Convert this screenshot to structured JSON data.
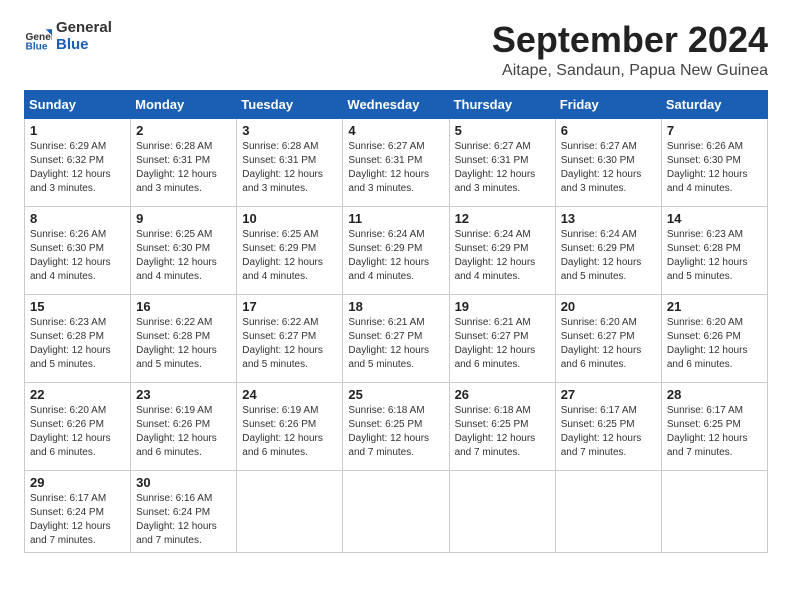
{
  "logo": {
    "line1": "General",
    "line2": "Blue"
  },
  "header": {
    "month": "September 2024",
    "location": "Aitape, Sandaun, Papua New Guinea"
  },
  "weekdays": [
    "Sunday",
    "Monday",
    "Tuesday",
    "Wednesday",
    "Thursday",
    "Friday",
    "Saturday"
  ],
  "weeks": [
    [
      {
        "day": "1",
        "sunrise": "6:29 AM",
        "sunset": "6:32 PM",
        "daylight": "12 hours and 3 minutes."
      },
      {
        "day": "2",
        "sunrise": "6:28 AM",
        "sunset": "6:31 PM",
        "daylight": "12 hours and 3 minutes."
      },
      {
        "day": "3",
        "sunrise": "6:28 AM",
        "sunset": "6:31 PM",
        "daylight": "12 hours and 3 minutes."
      },
      {
        "day": "4",
        "sunrise": "6:27 AM",
        "sunset": "6:31 PM",
        "daylight": "12 hours and 3 minutes."
      },
      {
        "day": "5",
        "sunrise": "6:27 AM",
        "sunset": "6:31 PM",
        "daylight": "12 hours and 3 minutes."
      },
      {
        "day": "6",
        "sunrise": "6:27 AM",
        "sunset": "6:30 PM",
        "daylight": "12 hours and 3 minutes."
      },
      {
        "day": "7",
        "sunrise": "6:26 AM",
        "sunset": "6:30 PM",
        "daylight": "12 hours and 4 minutes."
      }
    ],
    [
      {
        "day": "8",
        "sunrise": "6:26 AM",
        "sunset": "6:30 PM",
        "daylight": "12 hours and 4 minutes."
      },
      {
        "day": "9",
        "sunrise": "6:25 AM",
        "sunset": "6:30 PM",
        "daylight": "12 hours and 4 minutes."
      },
      {
        "day": "10",
        "sunrise": "6:25 AM",
        "sunset": "6:29 PM",
        "daylight": "12 hours and 4 minutes."
      },
      {
        "day": "11",
        "sunrise": "6:24 AM",
        "sunset": "6:29 PM",
        "daylight": "12 hours and 4 minutes."
      },
      {
        "day": "12",
        "sunrise": "6:24 AM",
        "sunset": "6:29 PM",
        "daylight": "12 hours and 4 minutes."
      },
      {
        "day": "13",
        "sunrise": "6:24 AM",
        "sunset": "6:29 PM",
        "daylight": "12 hours and 5 minutes."
      },
      {
        "day": "14",
        "sunrise": "6:23 AM",
        "sunset": "6:28 PM",
        "daylight": "12 hours and 5 minutes."
      }
    ],
    [
      {
        "day": "15",
        "sunrise": "6:23 AM",
        "sunset": "6:28 PM",
        "daylight": "12 hours and 5 minutes."
      },
      {
        "day": "16",
        "sunrise": "6:22 AM",
        "sunset": "6:28 PM",
        "daylight": "12 hours and 5 minutes."
      },
      {
        "day": "17",
        "sunrise": "6:22 AM",
        "sunset": "6:27 PM",
        "daylight": "12 hours and 5 minutes."
      },
      {
        "day": "18",
        "sunrise": "6:21 AM",
        "sunset": "6:27 PM",
        "daylight": "12 hours and 5 minutes."
      },
      {
        "day": "19",
        "sunrise": "6:21 AM",
        "sunset": "6:27 PM",
        "daylight": "12 hours and 6 minutes."
      },
      {
        "day": "20",
        "sunrise": "6:20 AM",
        "sunset": "6:27 PM",
        "daylight": "12 hours and 6 minutes."
      },
      {
        "day": "21",
        "sunrise": "6:20 AM",
        "sunset": "6:26 PM",
        "daylight": "12 hours and 6 minutes."
      }
    ],
    [
      {
        "day": "22",
        "sunrise": "6:20 AM",
        "sunset": "6:26 PM",
        "daylight": "12 hours and 6 minutes."
      },
      {
        "day": "23",
        "sunrise": "6:19 AM",
        "sunset": "6:26 PM",
        "daylight": "12 hours and 6 minutes."
      },
      {
        "day": "24",
        "sunrise": "6:19 AM",
        "sunset": "6:26 PM",
        "daylight": "12 hours and 6 minutes."
      },
      {
        "day": "25",
        "sunrise": "6:18 AM",
        "sunset": "6:25 PM",
        "daylight": "12 hours and 7 minutes."
      },
      {
        "day": "26",
        "sunrise": "6:18 AM",
        "sunset": "6:25 PM",
        "daylight": "12 hours and 7 minutes."
      },
      {
        "day": "27",
        "sunrise": "6:17 AM",
        "sunset": "6:25 PM",
        "daylight": "12 hours and 7 minutes."
      },
      {
        "day": "28",
        "sunrise": "6:17 AM",
        "sunset": "6:25 PM",
        "daylight": "12 hours and 7 minutes."
      }
    ],
    [
      {
        "day": "29",
        "sunrise": "6:17 AM",
        "sunset": "6:24 PM",
        "daylight": "12 hours and 7 minutes."
      },
      {
        "day": "30",
        "sunrise": "6:16 AM",
        "sunset": "6:24 PM",
        "daylight": "12 hours and 7 minutes."
      },
      null,
      null,
      null,
      null,
      null
    ]
  ]
}
